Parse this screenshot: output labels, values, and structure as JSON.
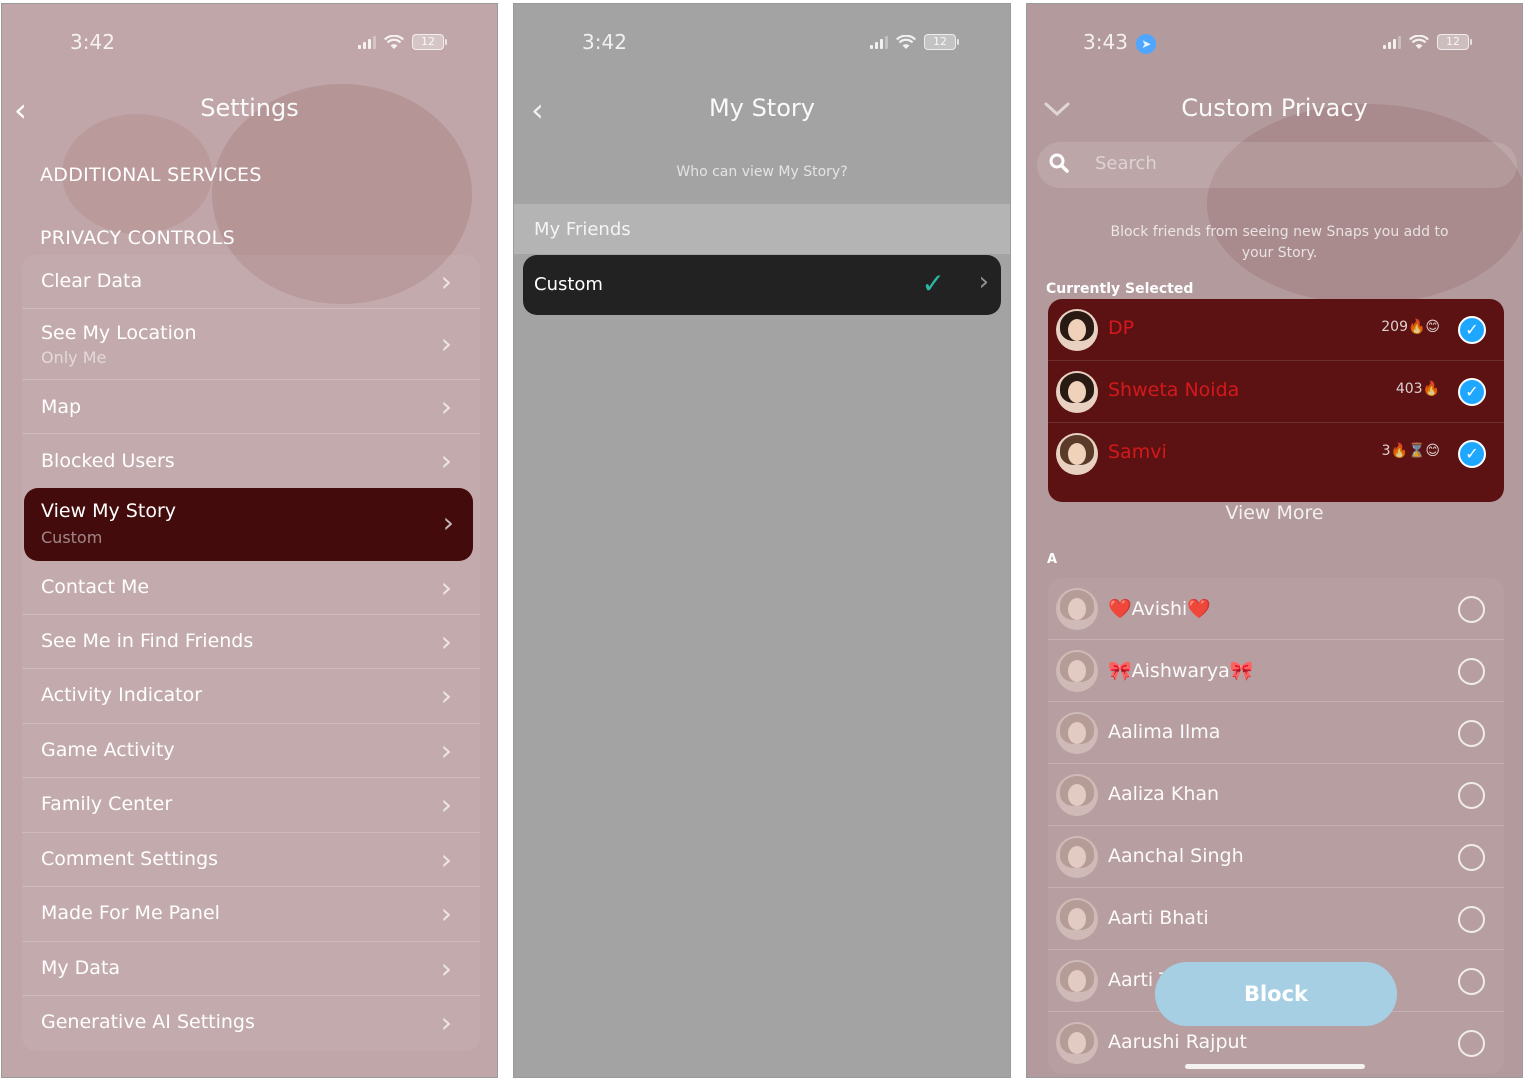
{
  "screen1": {
    "time": "3:42",
    "battery": "12",
    "title": "Settings",
    "section_additional": "ADDITIONAL SERVICES",
    "section_privacy": "PRIVACY CONTROLS",
    "items": [
      {
        "label": "Clear Data",
        "sub": ""
      },
      {
        "label": "See My Location",
        "sub": "Only Me"
      },
      {
        "label": "Map",
        "sub": ""
      },
      {
        "label": "Blocked Users",
        "sub": ""
      },
      {
        "label": "View My Story",
        "sub": "Custom"
      },
      {
        "label": "Contact Me",
        "sub": ""
      },
      {
        "label": "See Me in Find Friends",
        "sub": ""
      },
      {
        "label": "Activity Indicator",
        "sub": ""
      },
      {
        "label": "Game Activity",
        "sub": ""
      },
      {
        "label": "Family Center",
        "sub": ""
      },
      {
        "label": "Comment Settings",
        "sub": ""
      },
      {
        "label": "Made For Me Panel",
        "sub": ""
      },
      {
        "label": "My Data",
        "sub": ""
      },
      {
        "label": "Generative AI Settings",
        "sub": ""
      }
    ]
  },
  "screen2": {
    "time": "3:42",
    "battery": "12",
    "title": "My Story",
    "subtitle": "Who can view My Story?",
    "option_friends": "My Friends",
    "option_custom": "Custom"
  },
  "screen3": {
    "time": "3:43",
    "battery": "12",
    "title": "Custom Privacy",
    "search_placeholder": "Search",
    "description": "Block friends from seeing new Snaps you add to your Story.",
    "currently_selected": "Currently Selected",
    "selected": [
      {
        "name": "DP",
        "score": "209🔥😊"
      },
      {
        "name": "Shweta Noida",
        "score": "403🔥"
      },
      {
        "name": "Samvi",
        "score": "3🔥⌛😊"
      }
    ],
    "view_more": "View More",
    "letter": "A",
    "friends": [
      "❤️Avishi❤️",
      "🎀Aishwarya🎀",
      "Aalima Ilma",
      "Aaliza Khan",
      "Aanchal Singh",
      "Aarti Bhati",
      "Aarti T",
      "Aarushi Rajput"
    ],
    "block_label": "Block"
  }
}
